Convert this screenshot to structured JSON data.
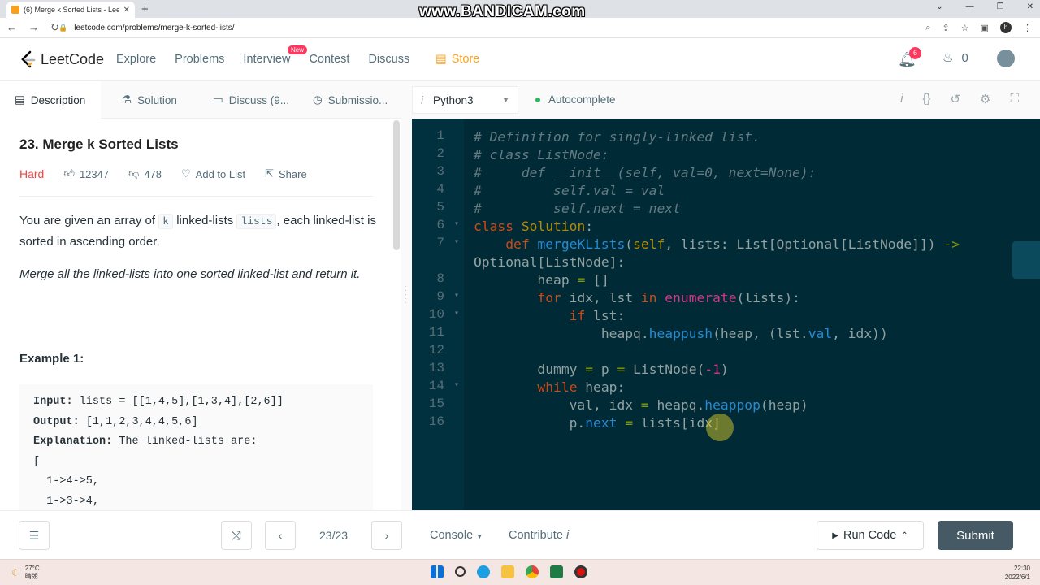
{
  "browser": {
    "tab_title": "(6) Merge k Sorted Lists - Leet",
    "url": "leetcode.com/problems/merge-k-sorted-lists/",
    "watermark": "www.BANDICAM.com",
    "profile_initial": "h"
  },
  "nav": {
    "brand": "LeetCode",
    "links": [
      "Explore",
      "Problems",
      "Interview",
      "Contest",
      "Discuss"
    ],
    "new_badge": "New",
    "store": "Store",
    "notifications": "6",
    "coins": "0"
  },
  "left_tabs": {
    "description": "Description",
    "solution": "Solution",
    "discuss": "Discuss (9...",
    "submissions": "Submissio..."
  },
  "problem": {
    "title": "23. Merge k Sorted Lists",
    "difficulty": "Hard",
    "likes": "12347",
    "dislikes": "478",
    "add_to_list": "Add to List",
    "share": "Share",
    "p1_a": "You are given an array of ",
    "p1_k": "k",
    "p1_b": " linked-lists ",
    "p1_lists": "lists",
    "p1_c": ", each linked-list is sorted in ascending order.",
    "p2": "Merge all the linked-lists into one sorted linked-list and return it.",
    "example_title": "Example 1:",
    "ex_input_label": "Input:",
    "ex_input": " lists = [[1,4,5],[1,3,4],[2,6]]",
    "ex_output_label": "Output:",
    "ex_output": " [1,1,2,3,4,4,5,6]",
    "ex_expl_label": "Explanation:",
    "ex_expl": " The linked-lists are:",
    "ex_line4": "[",
    "ex_line5": "  1->4->5,",
    "ex_line6": "  1->3->4,"
  },
  "editor": {
    "language": "Python3",
    "autocomplete": "Autocomplete",
    "line_numbers": [
      "1",
      "2",
      "3",
      "4",
      "5",
      "6",
      "7",
      "",
      "8",
      "9",
      "10",
      "11",
      "12",
      "13",
      "14",
      "15",
      "16"
    ],
    "code_lines": [
      "# Definition for singly-linked list.",
      "# class ListNode:",
      "#     def __init__(self, val=0, next=None):",
      "#         self.val = val",
      "#         self.next = next",
      "class Solution:",
      "    def mergeKLists(self, lists: List[Optional[ListNode]]) ->",
      "Optional[ListNode]:",
      "        heap = []",
      "        for idx, lst in enumerate(lists):",
      "            if lst:",
      "                heapq.heappush(heap, (lst.val, idx))",
      "",
      "        dummy = p = ListNode(-1)",
      "        while heap:",
      "            val, idx = heapq.heappop(heap)",
      "            p.next = lists[idx]"
    ]
  },
  "bottom": {
    "pager": "23/23",
    "console": "Console",
    "contribute": "Contribute",
    "run_code": "Run Code",
    "submit": "Submit"
  },
  "taskbar": {
    "temp": "27°C",
    "weather": "晴朗",
    "time": "22:30",
    "date": "2022/6/1"
  }
}
